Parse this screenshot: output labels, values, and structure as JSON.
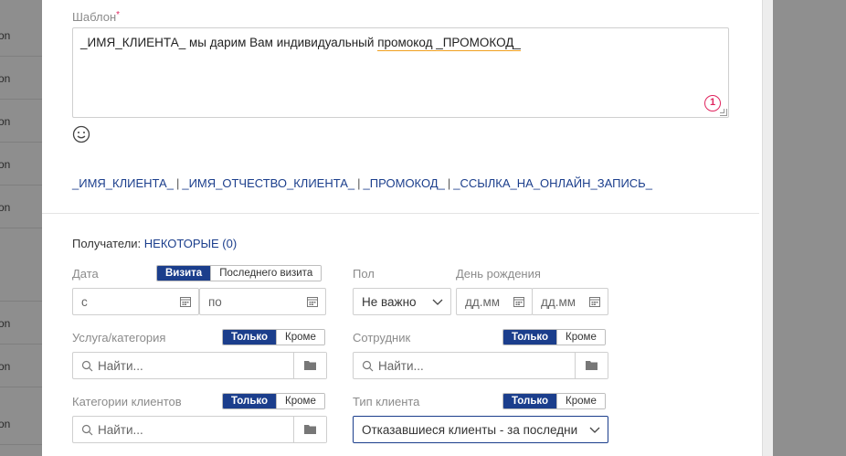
{
  "background": {
    "row_fragment": "on"
  },
  "template": {
    "label": "Шаблон",
    "required_mark": "*",
    "text_part1": "_ИМЯ_КЛИЕНТА_ мы дарим Вам индивидуальный ",
    "text_part2": "промокод  _ПРОМОКОД_",
    "counter": "1"
  },
  "variables": {
    "items": [
      "_ИМЯ_КЛИЕНТА_",
      "_ИМЯ_ОТЧЕСТВО_КЛИЕНТА_",
      "_ПРОМОКОД_",
      "_ССЫЛКА_НА_ОНЛАЙН_ЗАПИСЬ_"
    ],
    "separator": "|"
  },
  "recipients": {
    "label": "Получатели:",
    "value": "НЕКОТОРЫЕ (0)"
  },
  "date": {
    "label": "Дата",
    "toggle_visit": "Визита",
    "toggle_last_visit": "Последнего визита",
    "from_placeholder": "с",
    "to_placeholder": "по"
  },
  "gender": {
    "label": "Пол",
    "value": "Не важно"
  },
  "birthday": {
    "label": "День рождения",
    "from_placeholder": "дд.мм",
    "to_placeholder": "дд.мм"
  },
  "service": {
    "label": "Услуга/категория",
    "toggle_only": "Только",
    "toggle_except": "Кроме",
    "search_placeholder": "Найти..."
  },
  "staff": {
    "label": "Сотрудник",
    "toggle_only": "Только",
    "toggle_except": "Кроме",
    "search_placeholder": "Найти..."
  },
  "client_categories": {
    "label": "Категории клиентов",
    "toggle_only": "Только",
    "toggle_except": "Кроме",
    "search_placeholder": "Найти..."
  },
  "client_type": {
    "label": "Тип клиента",
    "toggle_only": "Только",
    "toggle_except": "Кроме",
    "value": "Отказавшиеся клиенты - за последни"
  },
  "colors": {
    "accent": "#1b3e8c",
    "error": "#e0245e",
    "underline": "#f0a020"
  }
}
